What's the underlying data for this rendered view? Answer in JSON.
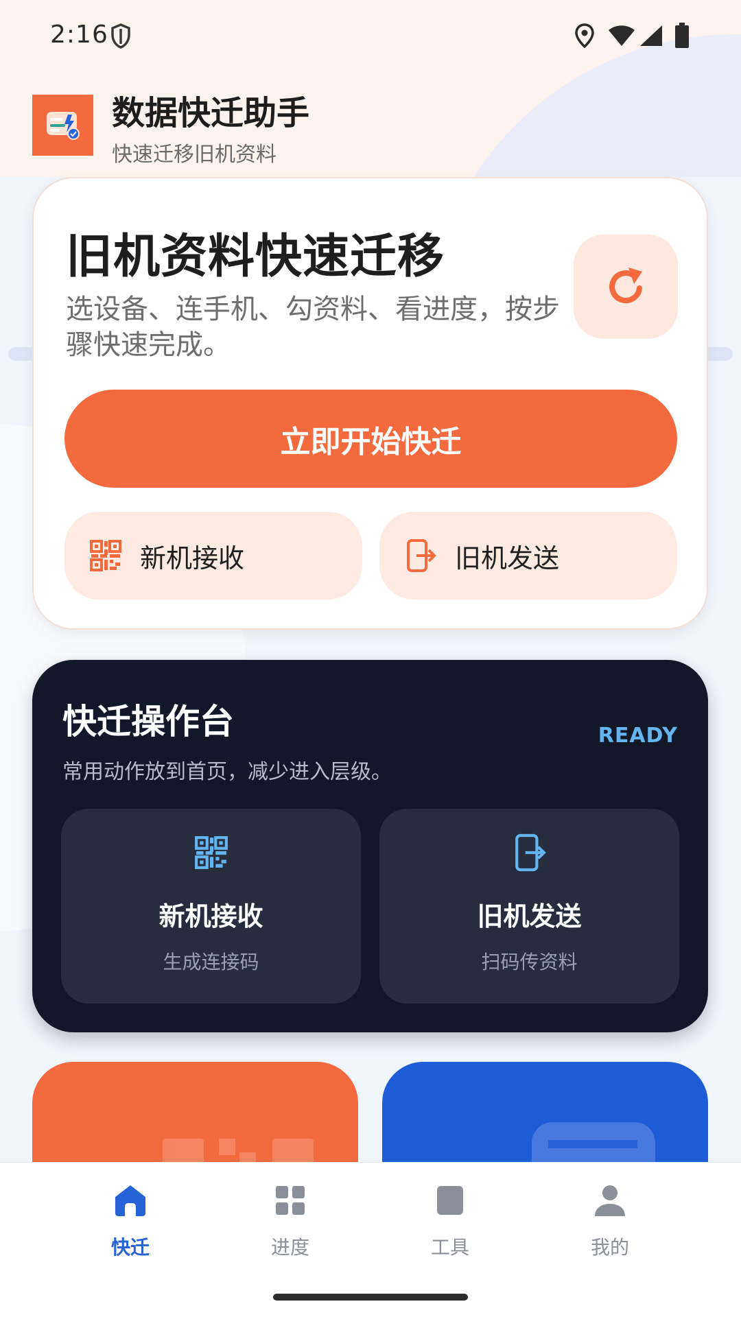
{
  "status_bar": {
    "time": "2:16",
    "icons": [
      "shield-icon",
      "location-icon",
      "wifi-icon",
      "signal-icon",
      "battery-icon"
    ]
  },
  "header": {
    "logo_icon": "app-logo-icon",
    "title": "数据快迁助手",
    "subtitle": "快速迁移旧机资料"
  },
  "hero": {
    "title": "旧机资料快速迁移",
    "description": "选设备、连手机、勾资料、看进度，按步骤快速完成。",
    "refresh_icon": "refresh-icon",
    "primary_label": "立即开始快迁",
    "secondary": [
      {
        "label": "新机接收",
        "icon": "qr-code-icon"
      },
      {
        "label": "旧机发送",
        "icon": "phone-export-icon"
      }
    ]
  },
  "console": {
    "title": "快迁操作台",
    "status": "READY",
    "description": "常用动作放到首页，减少进入层级。",
    "tiles": [
      {
        "title": "新机接收",
        "subtitle": "生成连接码",
        "icon": "qr-code-icon"
      },
      {
        "title": "旧机发送",
        "subtitle": "扫码传资料",
        "icon": "phone-export-icon"
      }
    ]
  },
  "bottom_nav": {
    "items": [
      {
        "label": "快迁",
        "icon": "home-icon",
        "active": true
      },
      {
        "label": "进度",
        "icon": "grid-icon",
        "active": false
      },
      {
        "label": "工具",
        "icon": "toolbox-icon",
        "active": false
      },
      {
        "label": "我的",
        "icon": "user-icon",
        "active": false
      }
    ]
  },
  "colors": {
    "accent": "#f26a3d",
    "dark": "#131828",
    "nav_active": "#2563d6",
    "ready": "#64b4f0",
    "promo_blue": "#1e5bd6"
  }
}
